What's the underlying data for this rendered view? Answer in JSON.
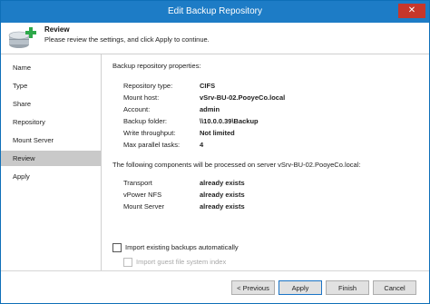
{
  "window": {
    "title": "Edit Backup Repository",
    "close_glyph": "✕"
  },
  "header": {
    "title": "Review",
    "subtitle": "Please review the settings, and click Apply to continue.",
    "icon": "database-add-icon",
    "icon_accent": "#2ea84a"
  },
  "sidebar": {
    "items": [
      {
        "label": "Name",
        "active": false
      },
      {
        "label": "Type",
        "active": false
      },
      {
        "label": "Share",
        "active": false
      },
      {
        "label": "Repository",
        "active": false
      },
      {
        "label": "Mount Server",
        "active": false
      },
      {
        "label": "Review",
        "active": true
      },
      {
        "label": "Apply",
        "active": false
      }
    ]
  },
  "main": {
    "section_label": "Backup repository properties:",
    "properties": [
      {
        "key": "Repository type:",
        "value": "CIFS"
      },
      {
        "key": "Mount host:",
        "value": "vSrv-BU-02.PooyeCo.local"
      },
      {
        "key": "Account:",
        "value": "admin"
      },
      {
        "key": "Backup folder:",
        "value": "\\\\10.0.0.39\\Backup"
      },
      {
        "key": "Write throughput:",
        "value": "Not limited"
      },
      {
        "key": "Max parallel tasks:",
        "value": "4"
      }
    ],
    "components_note": "The following components will be processed on server vSrv-BU-02.PooyeCo.local:",
    "components": [
      {
        "key": "Transport",
        "value": "already exists"
      },
      {
        "key": "vPower NFS",
        "value": "already exists"
      },
      {
        "key": "Mount Server",
        "value": "already exists"
      }
    ],
    "checkboxes": [
      {
        "label": "Import existing backups automatically",
        "checked": false,
        "enabled": true
      },
      {
        "label": "Import guest file system index",
        "checked": false,
        "enabled": false
      }
    ]
  },
  "footer": {
    "previous_label": "< Previous",
    "apply_label": "Apply",
    "finish_label": "Finish",
    "cancel_label": "Cancel"
  },
  "colors": {
    "titlebar": "#1d7cc6",
    "active_nav": "#c9c9c9",
    "close_button": "#c7372b",
    "button_face": "#e1e1e1",
    "primary_border": "#1b74c6"
  }
}
